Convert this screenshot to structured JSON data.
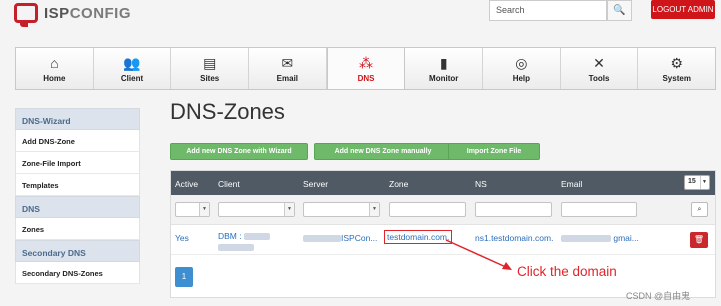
{
  "header": {
    "logo_text_a": "ISP",
    "logo_text_b": "CONFIG",
    "search_placeholder": "Search",
    "search_button": "🔍",
    "logout_label": "LOGOUT ADMIN"
  },
  "nav": [
    {
      "label": "Home",
      "icon": "⌂",
      "icon_name": "home-icon"
    },
    {
      "label": "Client",
      "icon": "👥",
      "icon_name": "client-icon"
    },
    {
      "label": "Sites",
      "icon": "▤",
      "icon_name": "sites-icon"
    },
    {
      "label": "Email",
      "icon": "✉",
      "icon_name": "email-icon"
    },
    {
      "label": "DNS",
      "icon": "⁂",
      "icon_name": "dns-icon"
    },
    {
      "label": "Monitor",
      "icon": "▮",
      "icon_name": "monitor-icon"
    },
    {
      "label": "Help",
      "icon": "◎",
      "icon_name": "help-icon"
    },
    {
      "label": "Tools",
      "icon": "✕",
      "icon_name": "tools-icon"
    },
    {
      "label": "System",
      "icon": "⚙",
      "icon_name": "system-icon"
    }
  ],
  "sidebar": {
    "group1": "DNS-Wizard",
    "item1": "Add DNS-Zone",
    "item2": "Zone-File Import",
    "item3": "Templates",
    "group2": "DNS",
    "item4": "Zones",
    "group3": "Secondary DNS",
    "item5": "Secondary DNS-Zones"
  },
  "main": {
    "title": "DNS-Zones",
    "btn_wizard": "Add new DNS Zone with Wizard",
    "btn_manual": "Add new DNS Zone manually",
    "btn_import": "Import Zone File"
  },
  "table": {
    "col_active": "Active",
    "col_client": "Client",
    "col_server": "Server",
    "col_zone": "Zone",
    "col_ns": "NS",
    "col_email": "Email",
    "rows_per_page": "15",
    "row": {
      "active": "Yes",
      "client": "DBM :",
      "server": "ISPCon...",
      "zone": "testdomain.com.",
      "ns": "ns1.testdomain.com.",
      "email": "gmai..."
    },
    "page": "1"
  },
  "annotation": "Click the domain",
  "watermark": "CSDN @自由鬼"
}
